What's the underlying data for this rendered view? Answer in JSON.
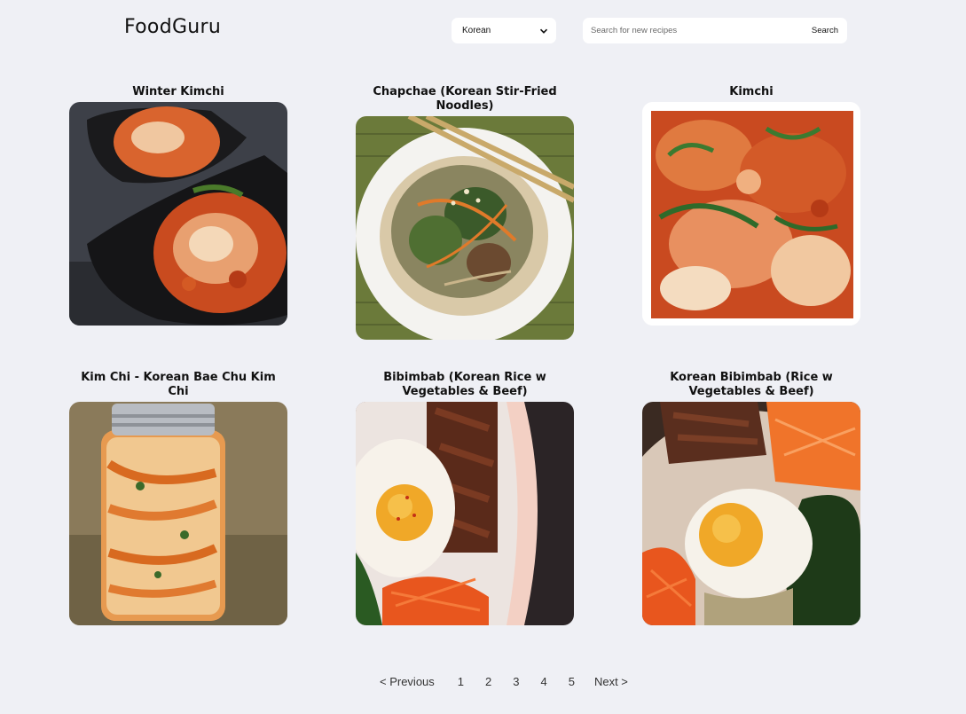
{
  "header": {
    "logo": "FoodGuru",
    "cuisine_select": {
      "selected": "Korean"
    },
    "search": {
      "placeholder": "Search for new recipes",
      "button_label": "Search"
    }
  },
  "recipes": [
    {
      "title": "Winter Kimchi"
    },
    {
      "title": "Chapchae (Korean Stir-Fried Noodles)"
    },
    {
      "title": "Kimchi"
    },
    {
      "title": "Kim Chi - Korean Bae Chu Kim Chi"
    },
    {
      "title": "Bibimbab (Korean Rice w Vegetables & Beef)"
    },
    {
      "title": "Korean Bibimbab (Rice w Vegetables & Beef)"
    }
  ],
  "pagination": {
    "previous": "< Previous",
    "pages": [
      "1",
      "2",
      "3",
      "4",
      "5"
    ],
    "next": "Next >"
  }
}
